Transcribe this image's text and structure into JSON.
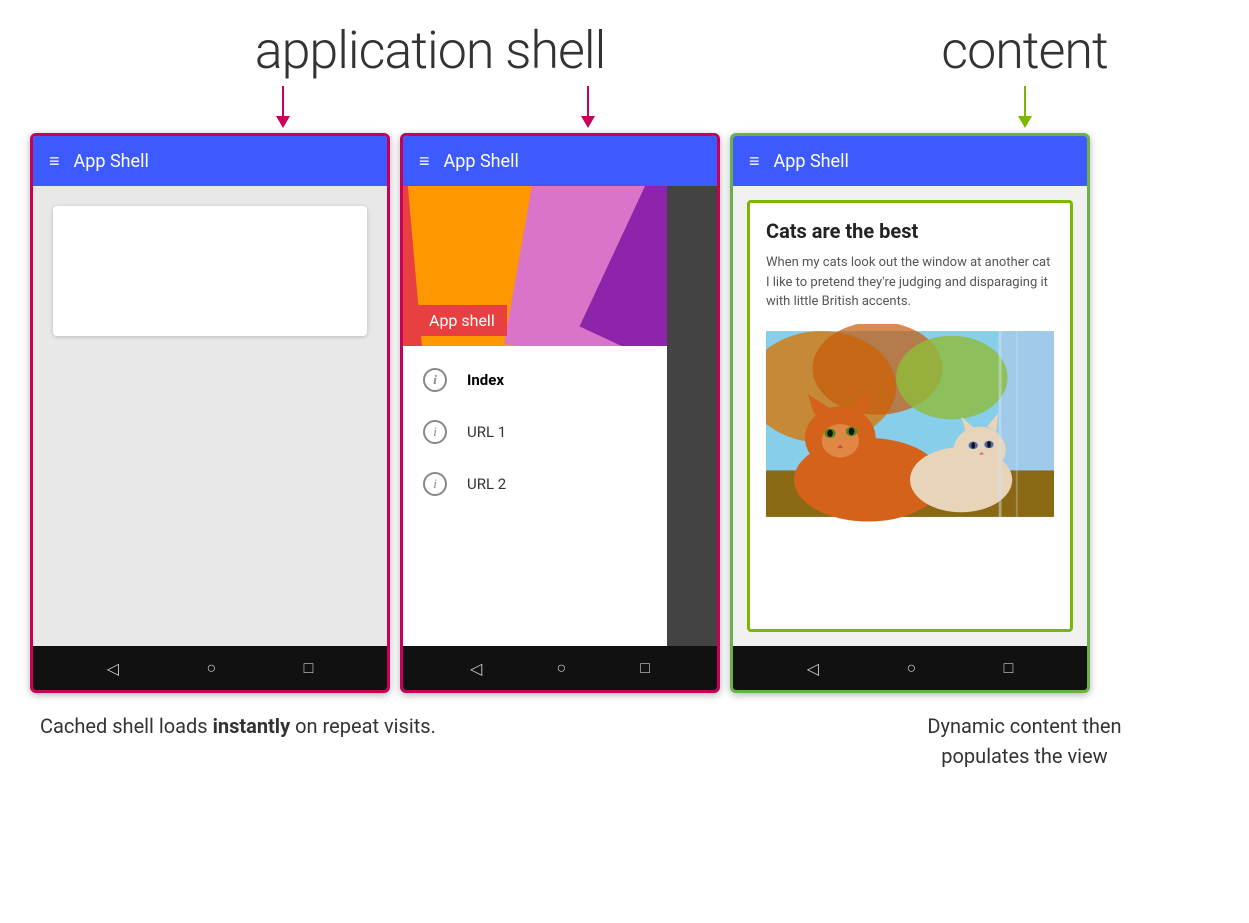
{
  "page": {
    "background": "#ffffff"
  },
  "labels": {
    "app_shell_heading": "application shell",
    "content_heading": "content",
    "caption_left_pre": "Cached shell loads ",
    "caption_left_bold": "instantly",
    "caption_left_post": " on repeat visits.",
    "caption_right_line1": "Dynamic content then",
    "caption_right_line2": "populates the view"
  },
  "phone1": {
    "app_bar_title": "App Shell",
    "nav": {
      "back": "◁",
      "home": "○",
      "recents": "□"
    }
  },
  "phone2": {
    "app_bar_title": "App Shell",
    "drawer_header_label": "App shell",
    "menu_items": [
      {
        "label": "Index",
        "active": true
      },
      {
        "label": "URL 1",
        "active": false
      },
      {
        "label": "URL 2",
        "active": false
      }
    ],
    "nav": {
      "back": "◁",
      "home": "○",
      "recents": "□"
    }
  },
  "phone3": {
    "app_bar_title": "App Shell",
    "content": {
      "title": "Cats are the best",
      "body": "When my cats look out the window at another cat I like to pretend they're judging and disparaging it with little British accents."
    },
    "nav": {
      "back": "◁",
      "home": "○",
      "recents": "□"
    }
  }
}
